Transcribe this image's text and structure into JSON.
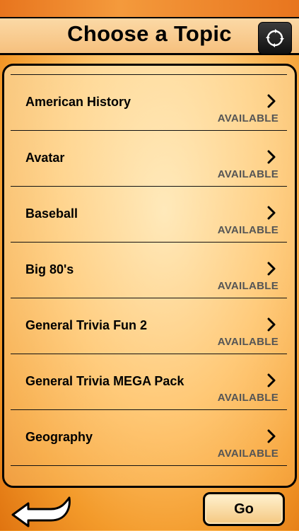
{
  "header": {
    "title": "Choose a Topic",
    "refresh_icon": "refresh-icon"
  },
  "topics": [
    {
      "label": "American History",
      "status": "AVAILABLE"
    },
    {
      "label": "Avatar",
      "status": "AVAILABLE"
    },
    {
      "label": "Baseball",
      "status": "AVAILABLE"
    },
    {
      "label": "Big 80's",
      "status": "AVAILABLE"
    },
    {
      "label": "General Trivia Fun 2",
      "status": "AVAILABLE"
    },
    {
      "label": "General Trivia MEGA Pack",
      "status": "AVAILABLE"
    },
    {
      "label": "Geography",
      "status": "AVAILABLE"
    }
  ],
  "footer": {
    "back_icon": "back-arrow-icon",
    "go_label": "Go"
  },
  "colors": {
    "accent": "#f39a2a",
    "panel_border": "#000000",
    "status_text": "#555555"
  }
}
